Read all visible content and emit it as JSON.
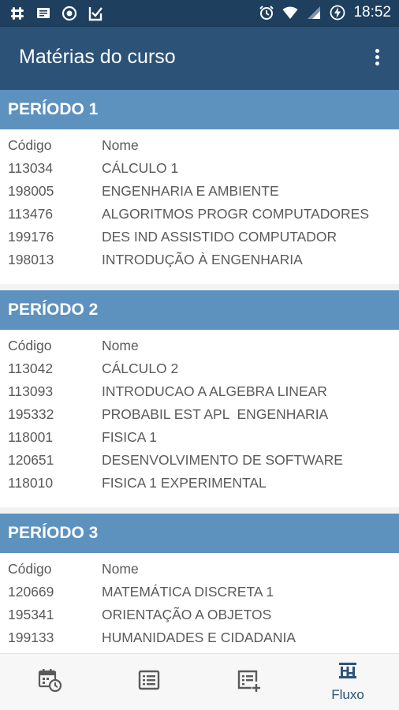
{
  "status_bar": {
    "time": "18:52",
    "icons": [
      "slack-icon",
      "message-icon",
      "record-icon",
      "tick-app-icon",
      "alarm-icon",
      "wifi-icon",
      "signal-icon",
      "battery-charging-icon"
    ]
  },
  "app_bar": {
    "title": "Matérias do curso",
    "menu_icon": "more-vert-icon"
  },
  "periods": [
    {
      "title": "PERÍODO 1",
      "col_code": "Código",
      "col_name": "Nome",
      "courses": [
        {
          "code": "113034",
          "name": "CÁLCULO 1"
        },
        {
          "code": "198005",
          "name": "ENGENHARIA E AMBIENTE"
        },
        {
          "code": "113476",
          "name": "ALGORITMOS PROGR COMPUTADORES"
        },
        {
          "code": "199176",
          "name": "DES IND ASSISTIDO COMPUTADOR"
        },
        {
          "code": "198013",
          "name": "INTRODUÇÃO À ENGENHARIA"
        }
      ]
    },
    {
      "title": "PERÍODO 2",
      "col_code": "Código",
      "col_name": "Nome",
      "courses": [
        {
          "code": "113042",
          "name": "CÁLCULO 2"
        },
        {
          "code": "113093",
          "name": "INTRODUCAO A ALGEBRA LINEAR"
        },
        {
          "code": "195332",
          "name": "PROBABIL EST APL  ENGENHARIA"
        },
        {
          "code": "118001",
          "name": "FISICA 1"
        },
        {
          "code": "120651",
          "name": "DESENVOLVIMENTO DE SOFTWARE"
        },
        {
          "code": "118010",
          "name": "FISICA 1 EXPERIMENTAL"
        }
      ]
    },
    {
      "title": "PERÍODO 3",
      "col_code": "Código",
      "col_name": "Nome",
      "courses": [
        {
          "code": "120669",
          "name": "MATEMÁTICA DISCRETA 1"
        },
        {
          "code": "195341",
          "name": "ORIENTAÇÃO A OBJETOS"
        },
        {
          "code": "199133",
          "name": "HUMANIDADES E CIDADANIA"
        }
      ]
    }
  ],
  "bottom_nav": {
    "items": [
      {
        "icon": "calendar-clock-icon",
        "label": ""
      },
      {
        "icon": "list-view-icon",
        "label": ""
      },
      {
        "icon": "list-add-icon",
        "label": ""
      },
      {
        "icon": "flow-icon",
        "label": "Fluxo",
        "active": true
      }
    ]
  },
  "colors": {
    "status_bar": "#1e3f5e",
    "app_bar": "#2c5377",
    "period_header": "#5d92bf",
    "body_text": "#5a5a5a",
    "nav_icon": "#5a5a5a",
    "nav_active": "#2c5377"
  }
}
